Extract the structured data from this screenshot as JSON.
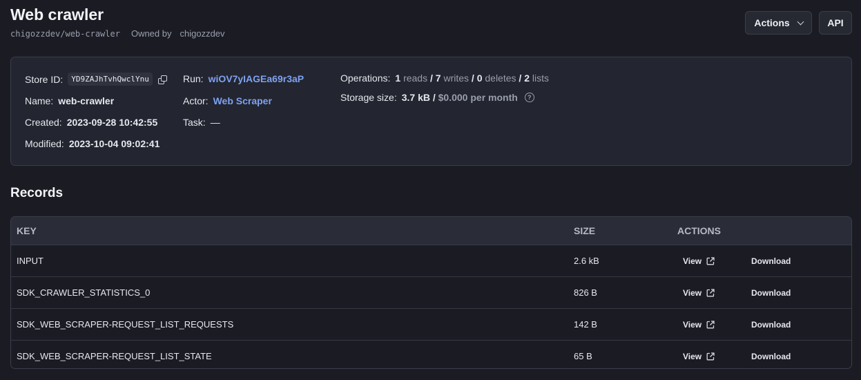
{
  "header": {
    "title": "Web crawler",
    "slug": "chigozzdev/web-crawler",
    "owned_label": "Owned by",
    "owner": "chigozzdev",
    "actions_label": "Actions",
    "api_label": "API"
  },
  "info": {
    "store_id_label": "Store ID:",
    "store_id": "YD9ZAJhTvhQwclYnu",
    "name_label": "Name:",
    "name": "web-crawler",
    "created_label": "Created:",
    "created": "2023-09-28 10:42:55",
    "modified_label": "Modified:",
    "modified": "2023-10-04 09:02:41",
    "run_label": "Run:",
    "run": "wiOV7yIAGEa69r3aP",
    "actor_label": "Actor:",
    "actor": "Web Scraper",
    "task_label": "Task:",
    "task": "—",
    "operations_label": "Operations:",
    "reads": "1",
    "reads_label": "reads",
    "writes": "7",
    "writes_label": "writes",
    "deletes": "0",
    "deletes_label": "deletes",
    "lists": "2",
    "lists_label": "lists",
    "storage_label": "Storage size:",
    "storage": "3.7 kB",
    "storage_cost": "$0.000 per month",
    "separator": "/"
  },
  "records": {
    "title": "Records",
    "columns": [
      "KEY",
      "SIZE",
      "ACTIONS"
    ],
    "view_label": "View",
    "download_label": "Download",
    "rows": [
      {
        "key": "INPUT",
        "size": "2.6 kB"
      },
      {
        "key": "SDK_CRAWLER_STATISTICS_0",
        "size": "826 B"
      },
      {
        "key": "SDK_WEB_SCRAPER-REQUEST_LIST_REQUESTS",
        "size": "142 B"
      },
      {
        "key": "SDK_WEB_SCRAPER-REQUEST_LIST_STATE",
        "size": "65 B"
      }
    ]
  }
}
